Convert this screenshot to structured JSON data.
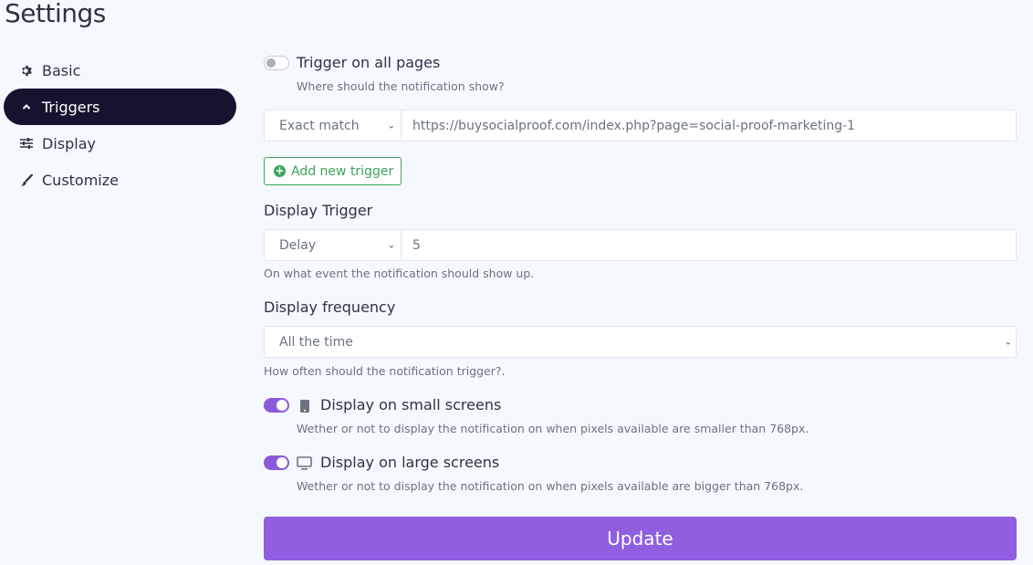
{
  "page": {
    "title": "Settings"
  },
  "sidebar": {
    "items": [
      {
        "label": "Basic",
        "icon": "gear-icon",
        "active": false
      },
      {
        "label": "Triggers",
        "icon": "chevron-up-icon",
        "active": true
      },
      {
        "label": "Display",
        "icon": "sliders-icon",
        "active": false
      },
      {
        "label": "Customize",
        "icon": "paintbrush-icon",
        "active": false
      }
    ]
  },
  "triggers": {
    "all_pages": {
      "label": "Trigger on all pages",
      "help": "Where should the notification show?",
      "enabled": false
    },
    "rule": {
      "match_type": "Exact match",
      "url": "https://buysocialproof.com/index.php?page=social-proof-marketing-1"
    },
    "add_button": "Add new trigger",
    "display_trigger": {
      "label": "Display Trigger",
      "type": "Delay",
      "value": "5",
      "help": "On what event the notification should show up."
    },
    "frequency": {
      "label": "Display frequency",
      "value": "All the time",
      "help": "How often should the notification trigger?."
    },
    "small_screens": {
      "label": "Display on small screens",
      "help": "Wether or not to display the notification on when pixels available are smaller than 768px.",
      "enabled": true
    },
    "large_screens": {
      "label": "Display on large screens",
      "help": "Wether or not to display the notification on when pixels available are bigger than 768px.",
      "enabled": true
    },
    "update_button": "Update"
  },
  "colors": {
    "accent": "#8f5fdf",
    "active_nav": "#17122d",
    "success": "#3aa55a"
  }
}
